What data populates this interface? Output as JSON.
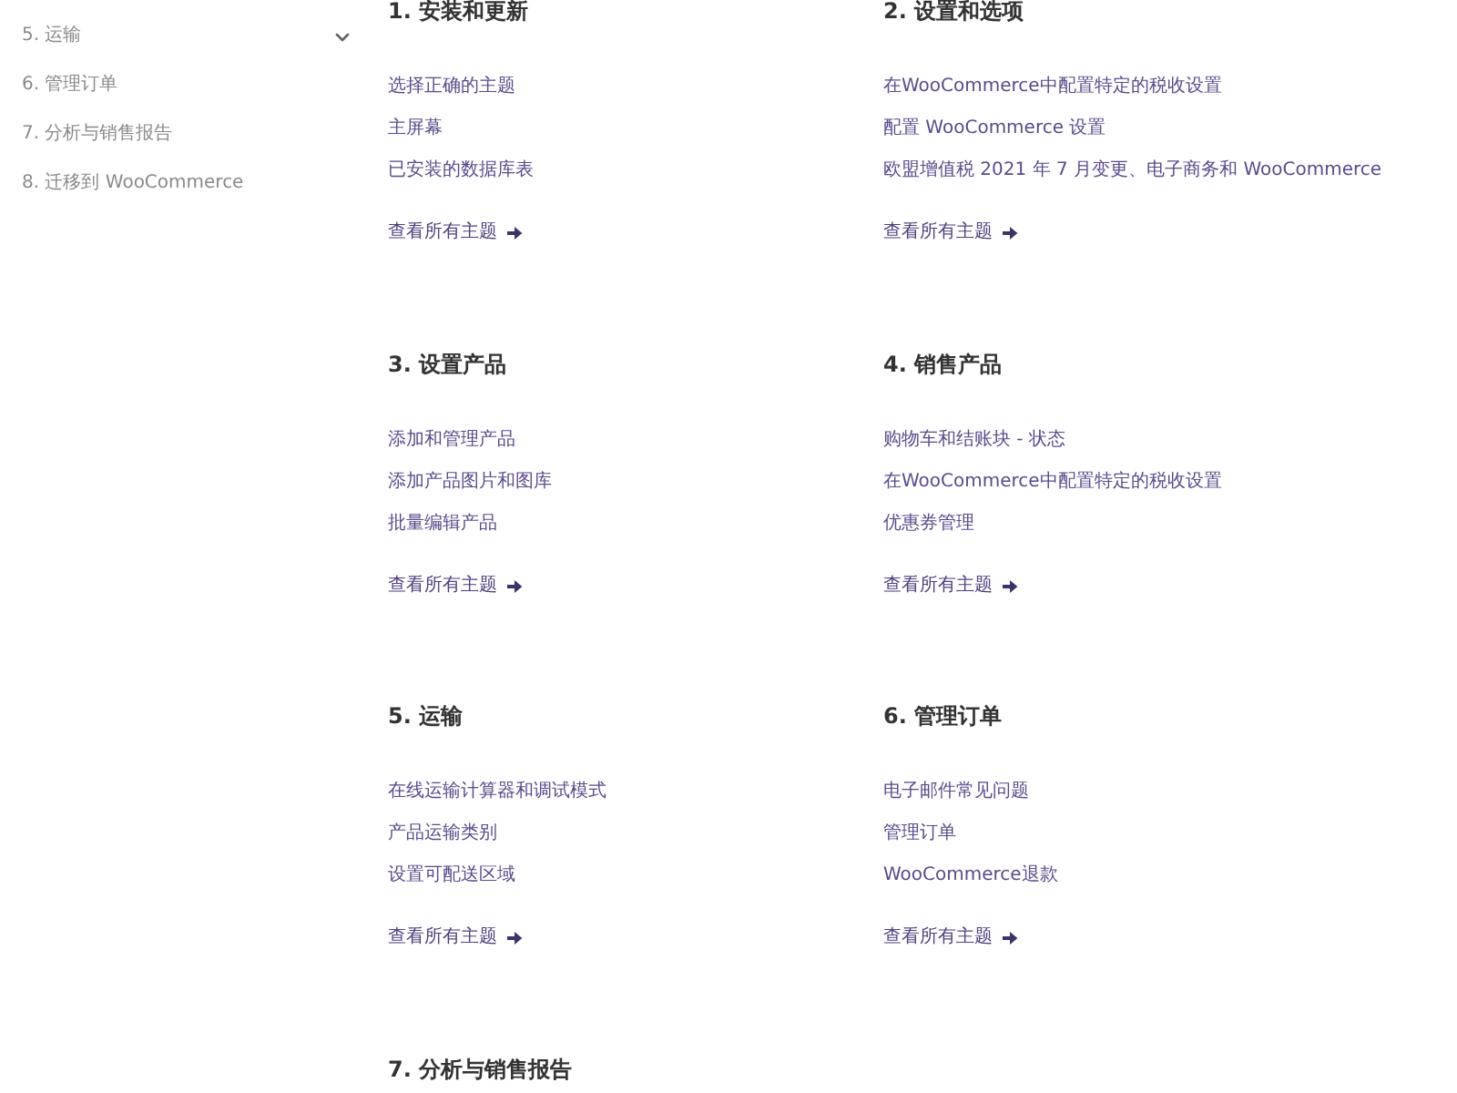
{
  "sidebar": {
    "items": [
      {
        "label": "5. 运输",
        "kind": "group",
        "expanded": false
      },
      {
        "label": "6. 管理订单",
        "kind": "link"
      },
      {
        "label": "7. 分析与销售报告",
        "kind": "link"
      },
      {
        "label": "8. 迁移到 WooCommerce",
        "kind": "link"
      }
    ]
  },
  "sections": [
    {
      "heading": "1. 安装和更新",
      "links": [
        "选择正确的主题",
        "主屏幕",
        "已安装的数据库表"
      ],
      "more": "查看所有主题"
    },
    {
      "heading": "2. 设置和选项",
      "links": [
        "在WooCommerce中配置特定的税收设置",
        "配置 WooCommerce 设置",
        "欧盟增值税 2021 年 7 月变更、电子商务和 WooCommerce"
      ],
      "more": "查看所有主题"
    },
    {
      "heading": "3. 设置产品",
      "links": [
        "添加和管理产品",
        "添加产品图片和图库",
        "批量编辑产品"
      ],
      "more": "查看所有主题"
    },
    {
      "heading": "4. 销售产品",
      "links": [
        "购物车和结账块 - 状态",
        "在WooCommerce中配置特定的税收设置",
        "优惠券管理"
      ],
      "more": "查看所有主题"
    },
    {
      "heading": "5. 运输",
      "links": [
        "在线运输计算器和调试模式",
        "产品运输类别",
        "设置可配送区域"
      ],
      "more": "查看所有主题"
    },
    {
      "heading": "6. 管理订单",
      "links": [
        "电子邮件常见问题",
        "管理订单",
        "WooCommerce退款"
      ],
      "more": "查看所有主题"
    },
    {
      "heading": "7. 分析与销售报告"
    }
  ]
}
